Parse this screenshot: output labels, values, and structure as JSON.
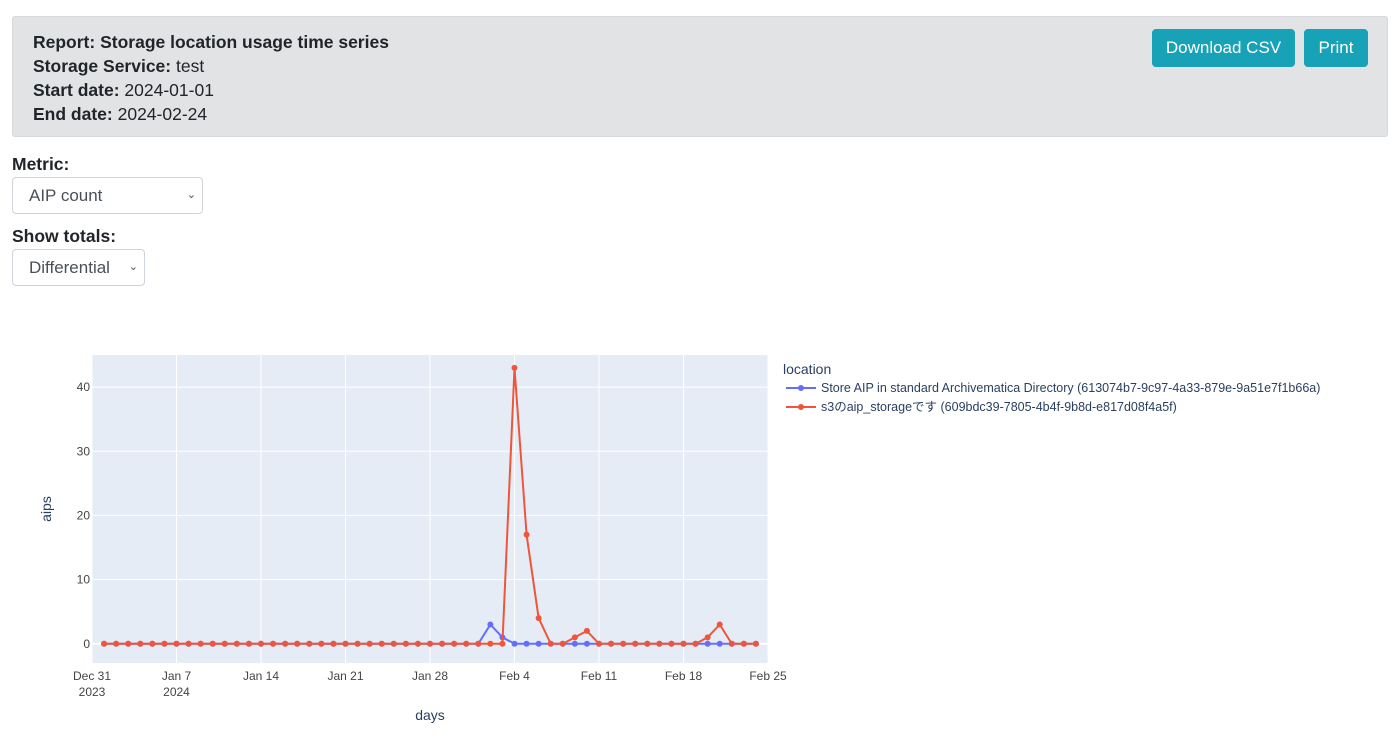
{
  "report": {
    "report_label": "Report:",
    "report_value": "Storage location usage time series",
    "service_label": "Storage Service:",
    "service_value": "test",
    "start_label": "Start date:",
    "start_value": "2024-01-01",
    "end_label": "End date:",
    "end_value": "2024-02-24"
  },
  "actions": {
    "download_csv": "Download CSV",
    "print": "Print"
  },
  "colors": {
    "button": "#17a2b8",
    "panel": "#e2e3e5",
    "plot_bg": "#e5ecf6",
    "series_1": "#636efa",
    "series_2": "#ef553b"
  },
  "metric": {
    "label": "Metric:",
    "selected": "AIP count"
  },
  "totals": {
    "label": "Show totals:",
    "selected": "Differential"
  },
  "chart_data": {
    "type": "line",
    "xlabel": "days",
    "ylabel": "aips",
    "legend_title": "location",
    "legend_placement": "right",
    "grid": true,
    "x_start": "2024-01-01",
    "x_end": "2024-02-24",
    "xlim": [
      "2023-12-31",
      "2024-02-25"
    ],
    "ylim": [
      -3,
      45
    ],
    "x_ticks": [
      {
        "date": "2023-12-31",
        "label": "Dec 31",
        "sub": "2023"
      },
      {
        "date": "2024-01-07",
        "label": "Jan 7",
        "sub": "2024"
      },
      {
        "date": "2024-01-14",
        "label": "Jan 14",
        "sub": ""
      },
      {
        "date": "2024-01-21",
        "label": "Jan 21",
        "sub": ""
      },
      {
        "date": "2024-01-28",
        "label": "Jan 28",
        "sub": ""
      },
      {
        "date": "2024-02-04",
        "label": "Feb 4",
        "sub": ""
      },
      {
        "date": "2024-02-11",
        "label": "Feb 11",
        "sub": ""
      },
      {
        "date": "2024-02-18",
        "label": "Feb 18",
        "sub": ""
      },
      {
        "date": "2024-02-25",
        "label": "Feb 25",
        "sub": ""
      }
    ],
    "y_ticks": [
      0,
      10,
      20,
      30,
      40
    ],
    "series": [
      {
        "name": "Store AIP in standard Archivematica Directory (613074b7-9c97-4a33-879e-9a51e7f1b66a)",
        "color": "#636efa",
        "values": [
          0,
          0,
          0,
          0,
          0,
          0,
          0,
          0,
          0,
          0,
          0,
          0,
          0,
          0,
          0,
          0,
          0,
          0,
          0,
          0,
          0,
          0,
          0,
          0,
          0,
          0,
          0,
          0,
          0,
          0,
          0,
          0,
          3,
          1,
          0,
          0,
          0,
          0,
          0,
          0,
          0,
          0,
          0,
          0,
          0,
          0,
          0,
          0,
          0,
          0,
          0,
          0,
          0,
          0,
          0
        ]
      },
      {
        "name": "s3のaip_storageです (609bdc39-7805-4b4f-9b8d-e817d08f4a5f)",
        "color": "#ef553b",
        "values": [
          0,
          0,
          0,
          0,
          0,
          0,
          0,
          0,
          0,
          0,
          0,
          0,
          0,
          0,
          0,
          0,
          0,
          0,
          0,
          0,
          0,
          0,
          0,
          0,
          0,
          0,
          0,
          0,
          0,
          0,
          0,
          0,
          0,
          0,
          43,
          17,
          4,
          0,
          0,
          1,
          2,
          0,
          0,
          0,
          0,
          0,
          0,
          0,
          0,
          0,
          1,
          3,
          0,
          0,
          0
        ]
      }
    ]
  }
}
